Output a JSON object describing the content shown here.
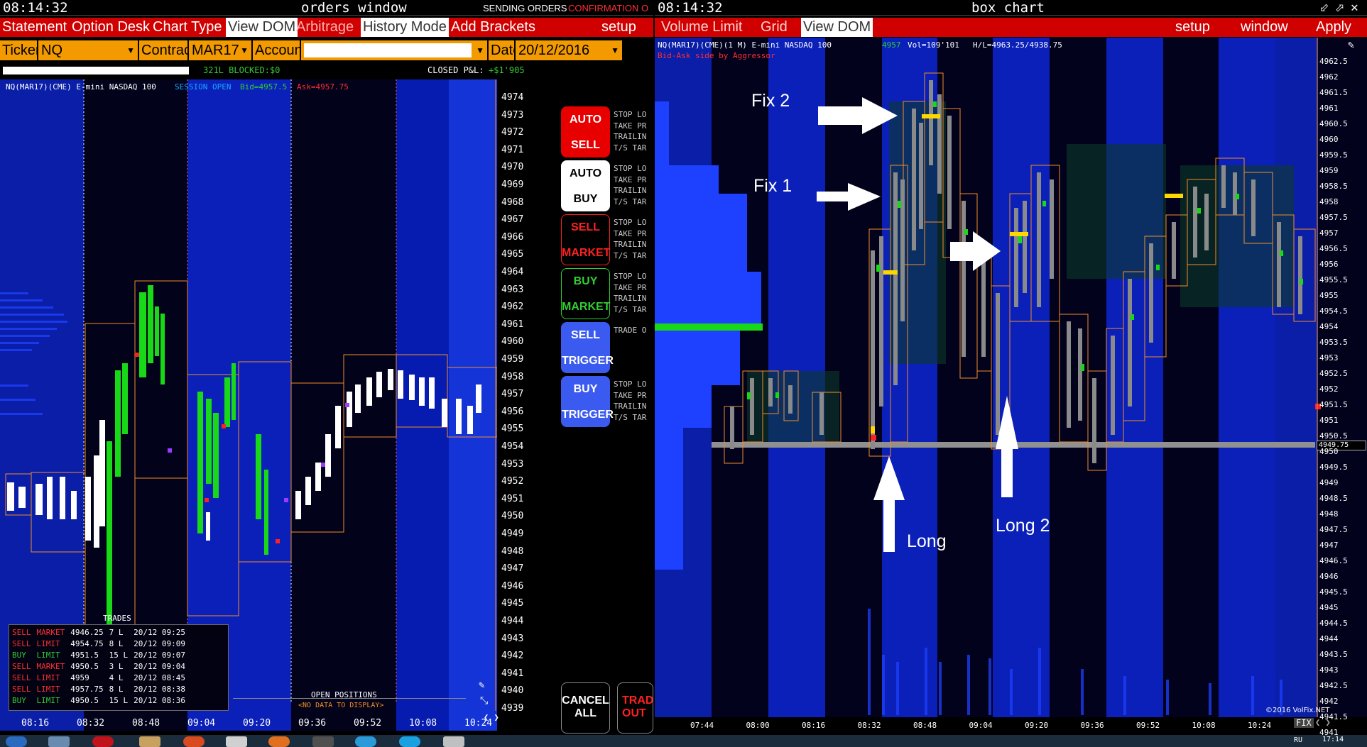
{
  "left": {
    "clock": "08:14:32",
    "title": "orders window",
    "status_sending": "SENDING ORDERS",
    "status_confirm": "CONFIRMATION O",
    "menu": [
      {
        "label": "Statement",
        "state": "normal"
      },
      {
        "label": "Option Desk",
        "state": "normal"
      },
      {
        "label": "Chart Type",
        "state": "normal"
      },
      {
        "label": "View DOM",
        "state": "active"
      },
      {
        "label": "Arbitrage",
        "state": "dim"
      },
      {
        "label": "History Mode",
        "state": "active"
      },
      {
        "label": "Add Brackets",
        "state": "normal"
      },
      {
        "label": "setup",
        "state": "normal"
      }
    ],
    "ticker_label": "Ticker",
    "ticker_value": "NQ",
    "contract_label": "Contract",
    "contract_value": "MAR17",
    "account_label": "Account",
    "account_value": "",
    "date_label": "Date",
    "date_value": "20/12/2016",
    "lots_text": "321L BLOCKED:$0",
    "closed_pl_label": "CLOSED P&L:",
    "closed_pl_value": "+$1'905",
    "chart_header": "NQ(MAR17)(CME) E-mini NASDAQ 100",
    "session": "SESSION OPEN",
    "bid": "Bid=4957.5",
    "ask": "Ask=4957.75",
    "price_ticks": [
      "4974",
      "4973",
      "4972",
      "4971",
      "4970",
      "4969",
      "4968",
      "4967",
      "4966",
      "4965",
      "4964",
      "4963",
      "4962",
      "4961",
      "4960",
      "4959",
      "4958",
      "4957",
      "4956",
      "4955",
      "4954",
      "4953",
      "4952",
      "4951",
      "4950",
      "4949",
      "4948",
      "4947",
      "4946",
      "4945",
      "4944",
      "4943",
      "4942",
      "4941",
      "4940",
      "4939"
    ],
    "time_ticks": [
      "08:16",
      "08:32",
      "08:48",
      "09:04",
      "09:20",
      "09:36",
      "09:52",
      "10:08",
      "10:24"
    ],
    "trades_title": "TRADES",
    "trades": [
      [
        "SELL",
        "MARKET",
        "4946.25",
        "7 L",
        "20/12 09:25"
      ],
      [
        "SELL",
        "LIMIT",
        "4954.75",
        "8 L",
        "20/12 09:09"
      ],
      [
        "BUY",
        "LIMIT",
        "4951.5",
        "15 L",
        "20/12 09:07"
      ],
      [
        "SELL",
        "MARKET",
        "4950.5",
        "3 L",
        "20/12 09:04"
      ],
      [
        "SELL",
        "LIMIT",
        "4959",
        "4 L",
        "20/12 08:45"
      ],
      [
        "SELL",
        "LIMIT",
        "4957.75",
        "8 L",
        "20/12 08:38"
      ],
      [
        "BUY",
        "LIMIT",
        "4950.5",
        "15 L",
        "20/12 08:36"
      ]
    ],
    "open_positions_title": "OPEN POSITIONS",
    "no_data": "<NO DATA TO DISPLAY>",
    "buttons": [
      {
        "line1": "AUTO",
        "line2": "SELL",
        "note": "STOP LO\nTAKE PR\nTRAILIN\nT/S TAR"
      },
      {
        "line1": "AUTO",
        "line2": "BUY",
        "note": "STOP LO\nTAKE PR\nTRAILIN\nT/S TAR"
      },
      {
        "line1": "SELL",
        "line2": "MARKET",
        "note": "STOP LO\nTAKE PR\nTRAILIN\nT/S TAR"
      },
      {
        "line1": "BUY",
        "line2": "MARKET",
        "note": "STOP LO\nTAKE PR\nTRAILIN\nT/S TAR"
      },
      {
        "line1": "SELL",
        "line2": "TRIGGER",
        "note": "TRADE O"
      },
      {
        "line1": "BUY",
        "line2": "TRIGGER",
        "note": "STOP LO\nTAKE PR\nTRAILIN\nT/S TAR"
      }
    ],
    "cancel_all_1": "CANCEL",
    "cancel_all_2": "ALL",
    "trade_out_1": "TRAD",
    "trade_out_2": "OUT"
  },
  "right": {
    "clock": "08:14:32",
    "title": "box chart",
    "menu": [
      {
        "label": "Volume Limit",
        "state": "normal"
      },
      {
        "label": "Grid",
        "state": "normal"
      },
      {
        "label": "View DOM",
        "state": "active"
      },
      {
        "label": "setup",
        "state": "normal"
      },
      {
        "label": "window",
        "state": "normal"
      },
      {
        "label": "Apply",
        "state": "normal"
      }
    ],
    "chart_header": "NQ(MAR17)(CME)(1 M) E-mini NASDAQ 100",
    "last": "4957",
    "vol": "Vol=109'101",
    "hl": "H/L=4963.25/4938.75",
    "subheader": "Bid-Ask side by Aggressor",
    "current_price": "4949.75",
    "price_ticks": [
      "4962.5",
      "4962",
      "4961.5",
      "4961",
      "4960.5",
      "4960",
      "4959.5",
      "4959",
      "4958.5",
      "4958",
      "4957.5",
      "4957",
      "4956.5",
      "4956",
      "4955.5",
      "4955",
      "4954.5",
      "4954",
      "4953.5",
      "4953",
      "4952.5",
      "4952",
      "4951.5",
      "4951",
      "4950.5",
      "4950",
      "4949.5",
      "4949",
      "4948.5",
      "4948",
      "4947.5",
      "4947",
      "4946.5",
      "4946",
      "4945.5",
      "4945",
      "4944.5",
      "4944",
      "4943.5",
      "4943",
      "4942.5",
      "4942",
      "4941.5",
      "4941"
    ],
    "time_ticks": [
      "07:44",
      "08:00",
      "08:16",
      "08:32",
      "08:48",
      "09:04",
      "09:20",
      "09:36",
      "09:52",
      "10:08",
      "10:24"
    ],
    "annotations": [
      "Fix 2",
      "Fix 1",
      "Long",
      "Long 2"
    ],
    "copyright": "©2016 VolFix.NET",
    "fix_label": "FIX"
  },
  "taskbar": {
    "clock": "17:14",
    "lang": "RU"
  }
}
